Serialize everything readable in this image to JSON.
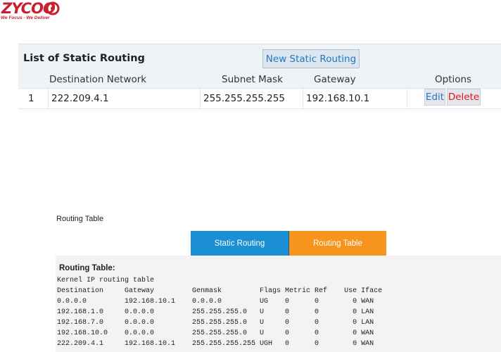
{
  "logo": {
    "wordmark": "ZYCOO",
    "tagline": "We Focus - We Deliver",
    "color": "#c8202f"
  },
  "static_routing": {
    "title": "List of Static Routing",
    "new_button": "New Static Routing",
    "columns": [
      "Destination Network",
      "Subnet Mask",
      "Gateway",
      "Options"
    ],
    "rows": [
      {
        "index": "1",
        "destination": "222.209.4.1",
        "mask": "255.255.255.255",
        "gateway": "192.168.10.1",
        "edit": "Edit",
        "delete": "Delete"
      }
    ]
  },
  "routing_section": {
    "heading": "Routing Table",
    "tabs": [
      {
        "label": "Static Routing",
        "active": false,
        "color": "#1b8fd3"
      },
      {
        "label": "Routing Table",
        "active": true,
        "color": "#f7941d"
      }
    ],
    "box_title": "Routing Table:",
    "kernel_title": "Kernel IP routing table",
    "columns": [
      "Destination",
      "Gateway",
      "Genmask",
      "Flags",
      "Metric",
      "Ref",
      "Use",
      "Iface"
    ],
    "rows": [
      [
        "0.0.0.0",
        "192.168.10.1",
        "0.0.0.0",
        "UG",
        "0",
        "0",
        "0",
        "WAN"
      ],
      [
        "192.168.1.0",
        "0.0.0.0",
        "255.255.255.0",
        "U",
        "0",
        "0",
        "0",
        "LAN"
      ],
      [
        "192.168.7.0",
        "0.0.0.0",
        "255.255.255.0",
        "U",
        "0",
        "0",
        "0",
        "LAN"
      ],
      [
        "192.168.10.0",
        "0.0.0.0",
        "255.255.255.0",
        "U",
        "0",
        "0",
        "0",
        "WAN"
      ],
      [
        "222.209.4.1",
        "192.168.10.1",
        "255.255.255.255",
        "UGH",
        "0",
        "0",
        "0",
        "WAN"
      ]
    ]
  }
}
